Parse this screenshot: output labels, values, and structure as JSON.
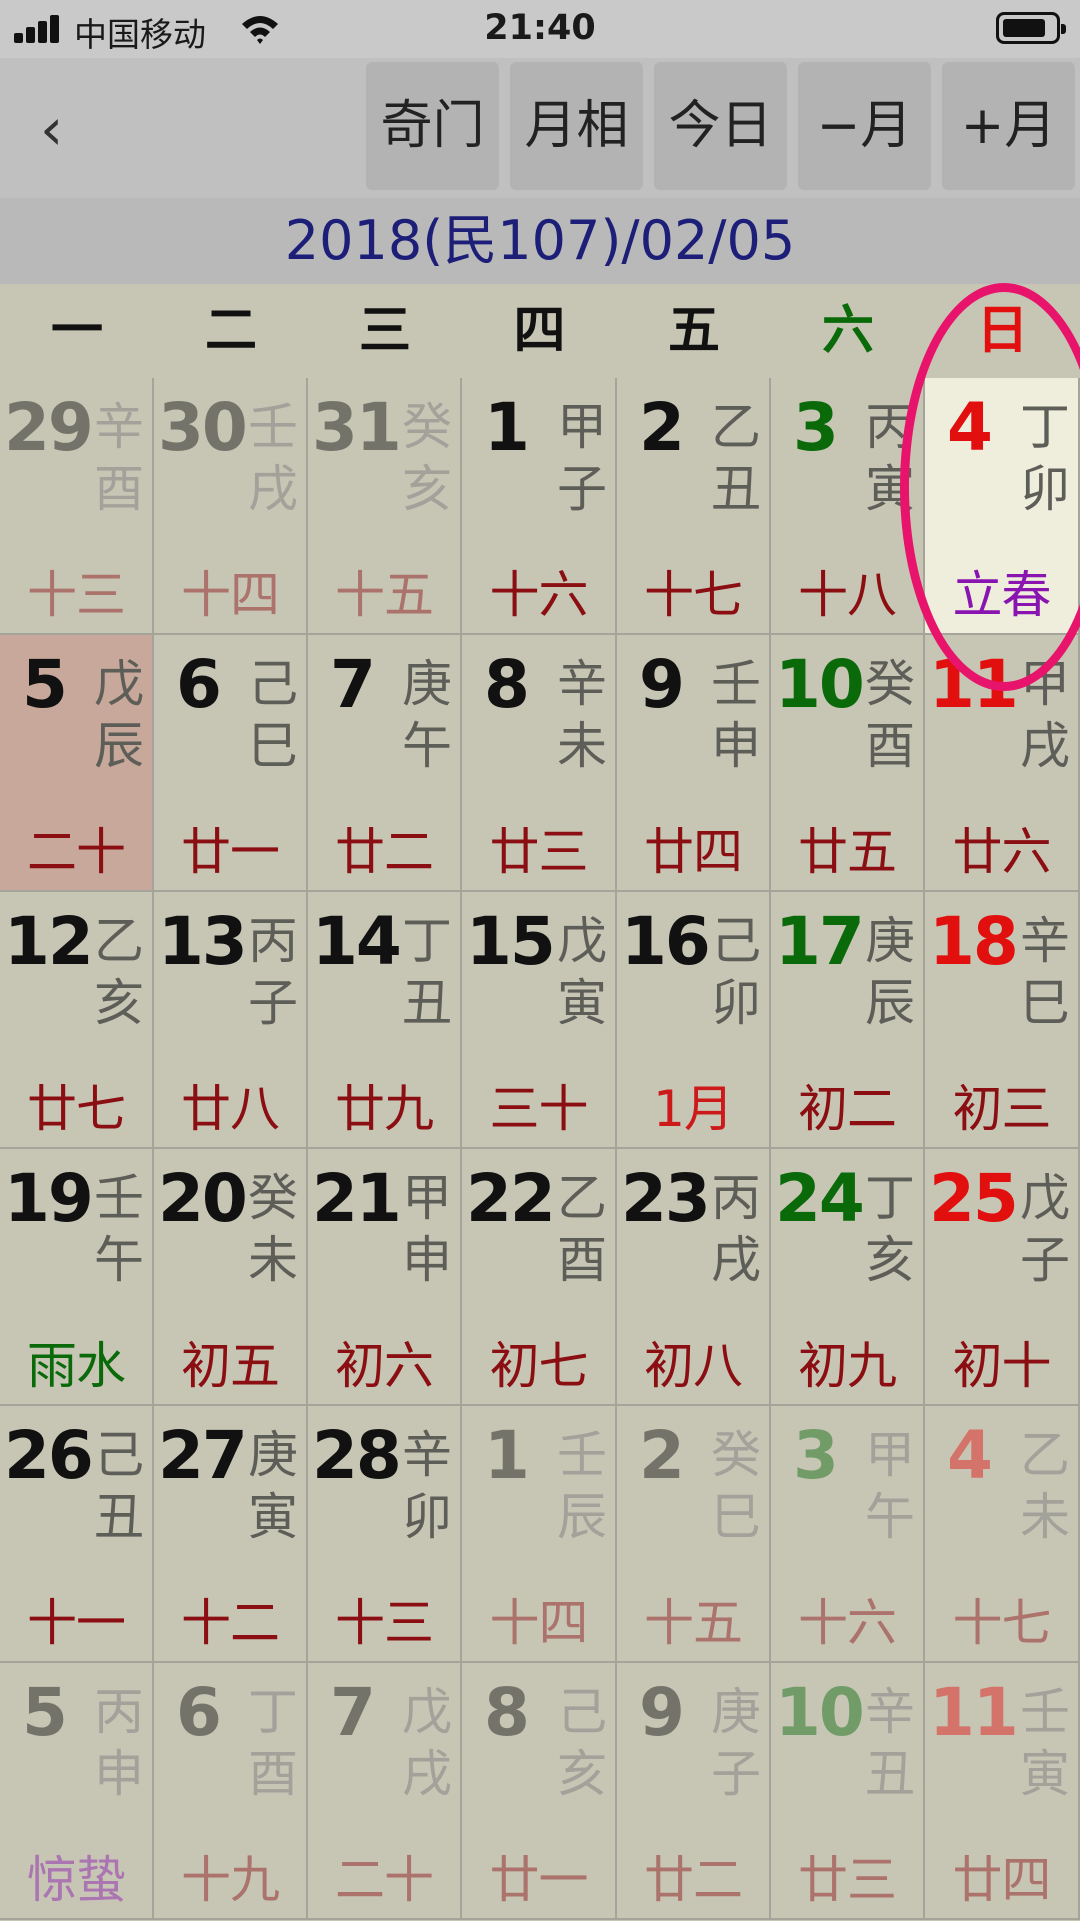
{
  "status_bar": {
    "carrier": "中国移动",
    "time": "21:40"
  },
  "toolbar": {
    "back_label": "‹",
    "buttons": [
      "奇门",
      "月相",
      "今日",
      "−月",
      "+月"
    ]
  },
  "date_header": "2018(民107)/02/05",
  "weekdays": [
    "一",
    "二",
    "三",
    "四",
    "五",
    "六",
    "日"
  ],
  "colors": {
    "current": "#111111",
    "faded": "#8d8c84",
    "saturday": "#0a6a0a",
    "sunday": "#e20f0f",
    "lunar_text": "#8b0f12",
    "solar_term": "#8a14b0",
    "highlight": "#e8146b",
    "today_cell": "#c7a89a"
  },
  "weeks": [
    [
      {
        "day": "29",
        "gz": "辛酉",
        "lunar": "十三",
        "faded": true
      },
      {
        "day": "30",
        "gz": "壬戌",
        "lunar": "十四",
        "faded": true
      },
      {
        "day": "31",
        "gz": "癸亥",
        "lunar": "十五",
        "faded": true
      },
      {
        "day": "1",
        "gz": "甲子",
        "lunar": "十六"
      },
      {
        "day": "2",
        "gz": "乙丑",
        "lunar": "十七"
      },
      {
        "day": "3",
        "gz": "丙寅",
        "lunar": "十八"
      },
      {
        "day": "4",
        "gz": "丁卯",
        "lunar": "立春",
        "term": true
      }
    ],
    [
      {
        "day": "5",
        "gz": "戊辰",
        "lunar": "二十",
        "today": true
      },
      {
        "day": "6",
        "gz": "己巳",
        "lunar": "廿一"
      },
      {
        "day": "7",
        "gz": "庚午",
        "lunar": "廿二"
      },
      {
        "day": "8",
        "gz": "辛未",
        "lunar": "廿三"
      },
      {
        "day": "9",
        "gz": "壬申",
        "lunar": "廿四"
      },
      {
        "day": "10",
        "gz": "癸酉",
        "lunar": "廿五"
      },
      {
        "day": "11",
        "gz": "甲戌",
        "lunar": "廿六"
      }
    ],
    [
      {
        "day": "12",
        "gz": "乙亥",
        "lunar": "廿七"
      },
      {
        "day": "13",
        "gz": "丙子",
        "lunar": "廿八"
      },
      {
        "day": "14",
        "gz": "丁丑",
        "lunar": "廿九"
      },
      {
        "day": "15",
        "gz": "戊寅",
        "lunar": "三十"
      },
      {
        "day": "16",
        "gz": "己卯",
        "lunar": "1月",
        "month": true
      },
      {
        "day": "17",
        "gz": "庚辰",
        "lunar": "初二"
      },
      {
        "day": "18",
        "gz": "辛巳",
        "lunar": "初三"
      }
    ],
    [
      {
        "day": "19",
        "gz": "壬午",
        "lunar": "雨水",
        "term": true
      },
      {
        "day": "20",
        "gz": "癸未",
        "lunar": "初五"
      },
      {
        "day": "21",
        "gz": "甲申",
        "lunar": "初六"
      },
      {
        "day": "22",
        "gz": "乙酉",
        "lunar": "初七"
      },
      {
        "day": "23",
        "gz": "丙戌",
        "lunar": "初八"
      },
      {
        "day": "24",
        "gz": "丁亥",
        "lunar": "初九"
      },
      {
        "day": "25",
        "gz": "戊子",
        "lunar": "初十"
      }
    ],
    [
      {
        "day": "26",
        "gz": "己丑",
        "lunar": "十一"
      },
      {
        "day": "27",
        "gz": "庚寅",
        "lunar": "十二"
      },
      {
        "day": "28",
        "gz": "辛卯",
        "lunar": "十三"
      },
      {
        "day": "1",
        "gz": "壬辰",
        "lunar": "十四",
        "faded": true
      },
      {
        "day": "2",
        "gz": "癸巳",
        "lunar": "十五",
        "faded": true
      },
      {
        "day": "3",
        "gz": "甲午",
        "lunar": "十六",
        "faded": true
      },
      {
        "day": "4",
        "gz": "乙未",
        "lunar": "十七",
        "faded": true
      }
    ],
    [
      {
        "day": "5",
        "gz": "丙申",
        "lunar": "惊蛰",
        "faded": true,
        "term": true
      },
      {
        "day": "6",
        "gz": "丁酉",
        "lunar": "十九",
        "faded": true
      },
      {
        "day": "7",
        "gz": "戊戌",
        "lunar": "二十",
        "faded": true
      },
      {
        "day": "8",
        "gz": "己亥",
        "lunar": "廿一",
        "faded": true
      },
      {
        "day": "9",
        "gz": "庚子",
        "lunar": "廿二",
        "faded": true
      },
      {
        "day": "10",
        "gz": "辛丑",
        "lunar": "廿三",
        "faded": true
      },
      {
        "day": "11",
        "gz": "壬寅",
        "lunar": "廿四",
        "faded": true
      }
    ]
  ]
}
